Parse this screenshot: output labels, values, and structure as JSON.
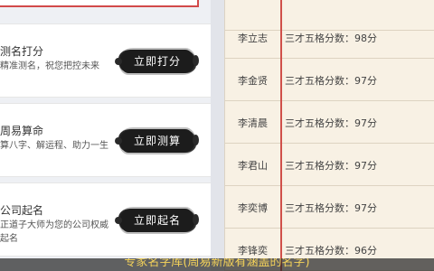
{
  "left_panel": {
    "services": [
      {
        "title": "测名打分",
        "desc_lines": [
          "精准测名，祝您把控未来"
        ],
        "button": "立即打分"
      },
      {
        "title": "周易算命",
        "desc_lines": [
          "算八字、解运程、助力一生"
        ],
        "button": "立即测算"
      },
      {
        "title": "公司起名",
        "desc_lines": [
          "正道子大师为您的公司权威",
          "起名"
        ],
        "button": "立即起名"
      }
    ]
  },
  "right_panel": {
    "rows": [
      {
        "name": "",
        "score": ""
      },
      {
        "name": "李立志",
        "score": "三才五格分数：98分"
      },
      {
        "name": "李金贤",
        "score": "三才五格分数：97分"
      },
      {
        "name": "李清晨",
        "score": "三才五格分数：97分"
      },
      {
        "name": "李君山",
        "score": "三才五格分数：97分"
      },
      {
        "name": "李奕博",
        "score": "三才五格分数：97分"
      },
      {
        "name": "李锋奕",
        "score": "三才五格分数：96分"
      }
    ]
  },
  "caption": "专家名字库(周易新版有涵盖的名字)",
  "colors": {
    "accent_red": "#d0504a",
    "caption_text": "#f4d25a",
    "button_bg": "#1c1c1c"
  }
}
